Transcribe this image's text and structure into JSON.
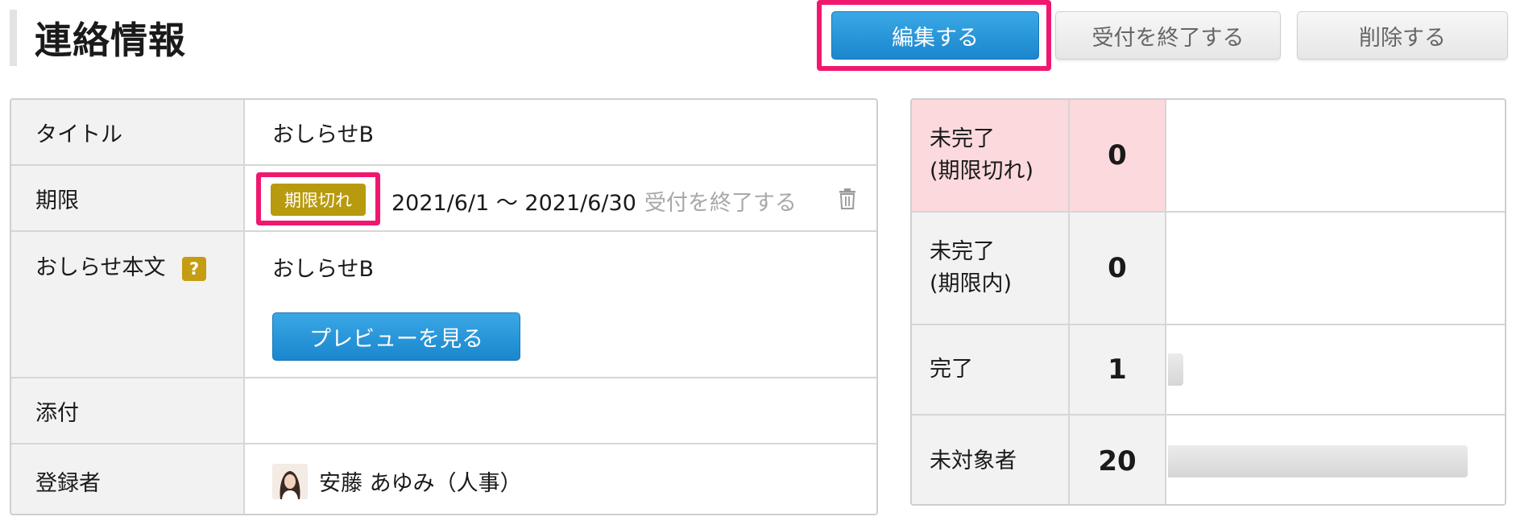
{
  "header": {
    "title": "連絡情報",
    "edit_button": "編集する",
    "close_button": "受付を終了する",
    "delete_button": "削除する"
  },
  "info": {
    "title_label": "タイトル",
    "title_value": "おしらせB",
    "deadline_label": "期限",
    "deadline_badge": "期限切れ",
    "deadline_range": "2021/6/1 〜 2021/6/30",
    "deadline_close_link": "受付を終了する",
    "body_label": "おしらせ本文",
    "body_help": "?",
    "body_value": "おしらせB",
    "preview_button": "プレビューを見る",
    "attachment_label": "添付",
    "registrant_label": "登録者",
    "registrant_value": "安藤 あゆみ（人事）"
  },
  "stats": [
    {
      "label_line1": "未完了",
      "label_line2": "(期限切れ)",
      "count": "0",
      "bar_fraction": 0
    },
    {
      "label_line1": "未完了",
      "label_line2": "(期限内)",
      "count": "0",
      "bar_fraction": 0
    },
    {
      "label_line1": "完了",
      "label_line2": "",
      "count": "1",
      "bar_fraction": 0.05
    },
    {
      "label_line1": "未対象者",
      "label_line2": "",
      "count": "20",
      "bar_fraction": 1.0
    }
  ],
  "colors": {
    "primary": "#1b86cd",
    "highlight": "#f0186e",
    "badge": "#b89a0e",
    "overdue_bg": "#fbd9dc"
  }
}
